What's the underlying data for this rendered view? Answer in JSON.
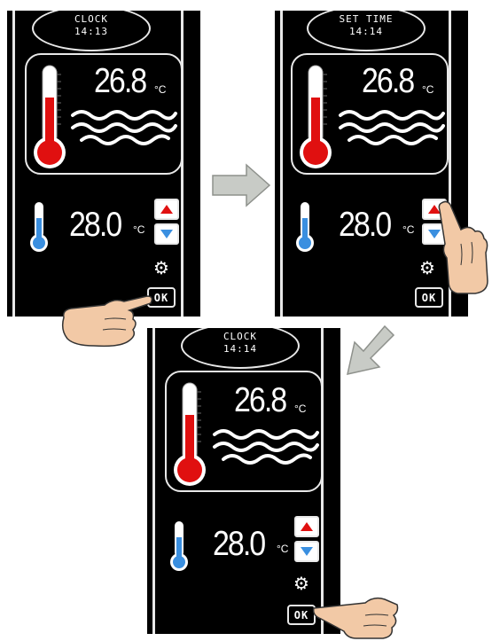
{
  "panels": [
    {
      "clock_label": "CLOCK",
      "clock_time": "14:13",
      "water_temp": "26.8",
      "water_unit": "°C",
      "set_temp": "28.0",
      "set_unit": "°C",
      "ok_label": "OK"
    },
    {
      "clock_label": "SET TIME",
      "clock_time": "14:14",
      "water_temp": "26.8",
      "water_unit": "°C",
      "set_temp": "28.0",
      "set_unit": "°C",
      "ok_label": "OK"
    },
    {
      "clock_label": "CLOCK",
      "clock_time": "14:14",
      "water_temp": "26.8",
      "water_unit": "°C",
      "set_temp": "28.0",
      "set_unit": "°C",
      "ok_label": "OK"
    }
  ],
  "colors": {
    "screen": "#000000",
    "thermo_red": "#e01010",
    "thermo_blue": "#3a8fe0",
    "arrow": "#c8cbc6",
    "skin": "#f2c9a6"
  },
  "icons": [
    "thermometer-icon",
    "waves-icon",
    "up-arrow-icon",
    "down-arrow-icon",
    "gear-icon",
    "pointing-hand-icon",
    "flow-arrow-icon"
  ]
}
